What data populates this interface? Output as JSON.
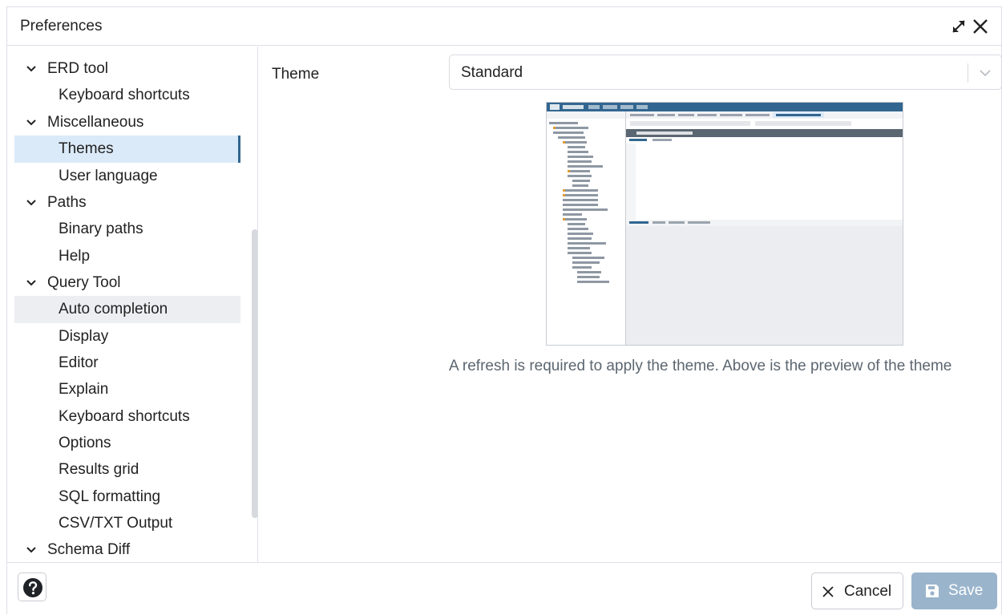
{
  "dialog": {
    "title": "Preferences"
  },
  "sidebar": {
    "items": [
      {
        "label": "ERD tool",
        "kind": "group"
      },
      {
        "label": "Keyboard shortcuts",
        "kind": "leaf"
      },
      {
        "label": "Miscellaneous",
        "kind": "group"
      },
      {
        "label": "Themes",
        "kind": "leaf",
        "state": "selected"
      },
      {
        "label": "User language",
        "kind": "leaf"
      },
      {
        "label": "Paths",
        "kind": "group"
      },
      {
        "label": "Binary paths",
        "kind": "leaf"
      },
      {
        "label": "Help",
        "kind": "leaf"
      },
      {
        "label": "Query Tool",
        "kind": "group"
      },
      {
        "label": "Auto completion",
        "kind": "leaf",
        "state": "hover"
      },
      {
        "label": "Display",
        "kind": "leaf"
      },
      {
        "label": "Editor",
        "kind": "leaf"
      },
      {
        "label": "Explain",
        "kind": "leaf"
      },
      {
        "label": "Keyboard shortcuts",
        "kind": "leaf"
      },
      {
        "label": "Options",
        "kind": "leaf"
      },
      {
        "label": "Results grid",
        "kind": "leaf"
      },
      {
        "label": "SQL formatting",
        "kind": "leaf"
      },
      {
        "label": "CSV/TXT Output",
        "kind": "leaf"
      },
      {
        "label": "Schema Diff",
        "kind": "group"
      }
    ]
  },
  "content": {
    "theme_label": "Theme",
    "theme_select": {
      "value": "Standard"
    },
    "help_text": "A refresh is required to apply the theme. Above is the preview of the theme"
  },
  "footer": {
    "cancel_label": "Cancel",
    "save_label": "Save"
  },
  "icons": {
    "expand": "expand-icon",
    "close": "close-icon",
    "chevron": "chevron-down-icon",
    "help": "question-circle-icon",
    "cancel": "x-icon",
    "save": "floppy-disk-icon"
  },
  "colors": {
    "selected_bg": "#dbeaf8",
    "selected_accent": "#326690",
    "hover_bg": "#eceef1",
    "save_button": "#9ab4cc",
    "help_text": "#5c6670"
  }
}
